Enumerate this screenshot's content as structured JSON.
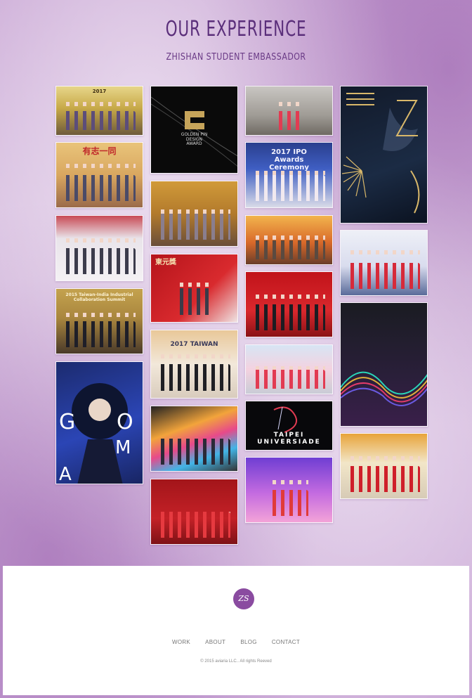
{
  "header": {
    "title": "OUR EXPERIENCE",
    "subtitle": "ZHISHAN STUDENT EMBASSADOR"
  },
  "gallery": {
    "tile_captions": [
      "2017",
      "有志一同",
      "",
      "2015 Taiwan-India Industrial Collaboration Summit",
      "",
      "GOLDEN PIN DESIGN AWARD",
      "",
      "東元獎",
      "2017 TAIWAN",
      "",
      "",
      "",
      "2017 IPO Awards Ceremony",
      "",
      "",
      "",
      "TAIPEI UNIVERSIADE",
      "",
      "",
      "",
      "",
      ""
    ]
  },
  "footer": {
    "logo_text": "ZS",
    "nav": {
      "work": "WORK",
      "about": "ABOUT",
      "blog": "BLOG",
      "contact": "CONTACT"
    },
    "copyright": "© 2015 aviaria LLC.. All rights Reeved"
  },
  "colors": {
    "accent": "#5b2f7b",
    "logo_bg": "#8a4ba0",
    "background": "#d2b4dc"
  }
}
